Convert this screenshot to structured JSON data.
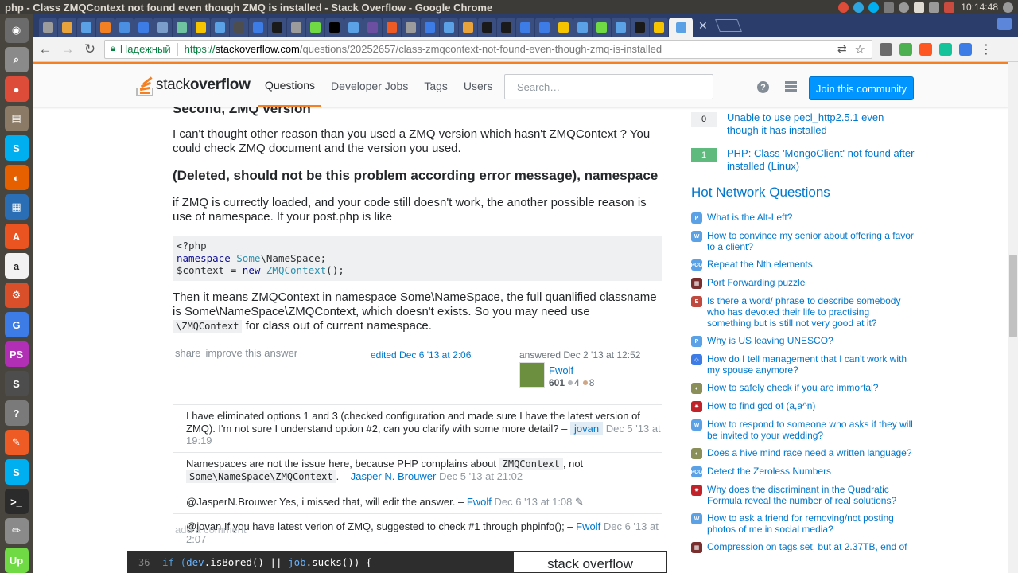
{
  "os": {
    "window_title": "php - Class ZMQContext not found even though ZMQ is installed - Stack Overflow - Google Chrome",
    "clock": "10:14:48",
    "tray_icons": [
      "chrome-icon",
      "telegram-icon",
      "skype-icon",
      "transfer-icon",
      "power-icon",
      "keyboard-layout-icon",
      "wifi-icon",
      "volume-mute-icon",
      "clock-icon"
    ]
  },
  "launcher": {
    "apps": [
      {
        "name": "ubuntu-dash",
        "color": "#6b6b6b",
        "glyph": "◉"
      },
      {
        "name": "screenshot-app",
        "color": "#8a8a8a",
        "glyph": "⌕"
      },
      {
        "name": "chrome-app",
        "color": "#dd4b39",
        "glyph": "●"
      },
      {
        "name": "files-app",
        "color": "#8a7a66",
        "glyph": "▤"
      },
      {
        "name": "skype-app",
        "color": "#00aff0",
        "glyph": "S"
      },
      {
        "name": "firefox-app",
        "color": "#e66000",
        "glyph": "◐"
      },
      {
        "name": "writer-app",
        "color": "#2a6eb6",
        "glyph": "▦"
      },
      {
        "name": "software-center-app",
        "color": "#e95420",
        "glyph": "A"
      },
      {
        "name": "amazon-app",
        "color": "#f2f2f2",
        "glyph": "a"
      },
      {
        "name": "settings-app",
        "color": "#d94f2a",
        "glyph": "⚙"
      },
      {
        "name": "grammarly-app",
        "color": "#3d7ce6",
        "glyph": "G"
      },
      {
        "name": "phpstorm-app",
        "color": "#b02fb5",
        "glyph": "PS"
      },
      {
        "name": "sublime-app",
        "color": "#4d4d4d",
        "glyph": "S"
      },
      {
        "name": "help-app",
        "color": "#7a7a7a",
        "glyph": "?"
      },
      {
        "name": "postman-app",
        "color": "#ef5b25",
        "glyph": "✎"
      },
      {
        "name": "skype-business-app",
        "color": "#00aff0",
        "glyph": "S"
      },
      {
        "name": "terminal-app",
        "color": "#2b2b2b",
        "glyph": ">_"
      },
      {
        "name": "pencil-app",
        "color": "#8a8a8a",
        "glyph": "✏"
      },
      {
        "name": "upwork-app",
        "color": "#6fda44",
        "glyph": "Up"
      }
    ]
  },
  "browser": {
    "tab_favicons": [
      "#9c9c9c",
      "#e8a33c",
      "#5aa1e6",
      "#f48024",
      "#4a8fe2",
      "#3d7ce6",
      "#7a9ec9",
      "#6fc3a0",
      "#f7c400",
      "#5aa1e6",
      "#4d4d4d",
      "#3d7ce6",
      "#1a1a1a",
      "#9c9c9c",
      "#6fda44",
      "#000000",
      "#5aa1e6",
      "#6c4fa0",
      "#ef5b25",
      "#9c9c9c",
      "#3d7ce6",
      "#5aa1e6",
      "#e8a33c",
      "#1a1a1a",
      "#1a1a1a",
      "#3d7ce6",
      "#3d7ce6",
      "#f7c400",
      "#5aa1e6",
      "#6fda44",
      "#5aa1e6",
      "#1a1a1a",
      "#f7c400",
      "#5aa1e6"
    ],
    "secure_label": "Надежный",
    "url_scheme": "https://",
    "url_host": "stackoverflow.com",
    "url_path": "/questions/20252657/class-zmqcontext-not-found-even-though-zmq-is-installed",
    "extension_colors": [
      "#6b6b6b",
      "#4caf50",
      "#ff5722",
      "#15c39a",
      "#3d7ce6"
    ]
  },
  "so": {
    "logo_light": "stack",
    "logo_bold": "overflow",
    "nav": [
      "Questions",
      "Developer Jobs",
      "Tags",
      "Users"
    ],
    "search_placeholder": "Search…",
    "help_glyph": "?",
    "join_label": "Join this community"
  },
  "answer": {
    "heading_prev": "Second, ZMQ version",
    "p1": "I can't thought other reason than you used a ZMQ version which hasn't ZMQContext ? You could check ZMQ document and the version you used.",
    "heading2": "(Deleted, should not be this problem according error message), namespace",
    "p2": "if ZMQ is currectly loaded, and your code still doesn't work, the another possible reason is use of namespace. If your post.php is like",
    "code_line1": "<?php",
    "code_line2_kw": "namespace",
    "code_line2_ns1": "Some",
    "code_line2_rest": "\\NameSpace;",
    "code_line3_var": "$context = ",
    "code_line3_kw": "new",
    "code_line3_cls": "ZMQContext",
    "code_line3_end": "();",
    "p3_text": "Then it means ZMQContext in namespace Some\\NameSpace, the full quanlified classname is Some\\NameSpace\\ZMQContext, which doesn't exists. So you may need use",
    "p3_code": "\\ZMQContext",
    "p3_tail": "for class out of current namespace.",
    "share": "share",
    "improve": "improve this answer",
    "edited": "edited Dec 6 '13 at 2:06",
    "answered": "answered Dec 2 '13 at 12:52",
    "user": "Fwolf",
    "rep": "601",
    "silver": "4",
    "bronze": "8"
  },
  "comments": [
    {
      "text": "I have eliminated options 1 and 3 (checked configuration and made sure I have the latest version of ZMQ). I'm not sure I understand option #2, can you clarify with some more detail? –",
      "user": "jovan",
      "date": "Dec 5 '13 at 19:19"
    },
    {
      "pre": "Namespaces are not the issue here, because PHP complains about",
      "code1": "ZMQContext",
      "mid": ", not",
      "code2": "Some\\NameSpace\\ZMQContext",
      "post": ". –",
      "user": "Jasper N. Brouwer",
      "date": "Dec 5 '13 at 21:02"
    },
    {
      "text": "@JasperN.Brouwer Yes, i missed that, will edit the answer. –",
      "user": "Fwolf",
      "date": "Dec 6 '13 at 1:08",
      "edit_glyph": "✎"
    },
    {
      "text": "@jovan If you have latest verion of ZMQ, suggested to check #1 through phpinfo(); –",
      "user": "Fwolf",
      "date": "Dec 6 '13 at 2:07"
    }
  ],
  "add_comment": "add a comment",
  "banner": {
    "line_no": "36",
    "code_pre": "if (",
    "code_dev": "dev",
    "code_mid": ".isBored() || ",
    "code_job": "job",
    "code_post": ".sucks()) {",
    "logo": "stack overflow"
  },
  "related": [
    {
      "score": "0",
      "accepted": false,
      "title": "Unable to use pecl_http2.5.1 even though it has installed"
    },
    {
      "score": "1",
      "accepted": true,
      "title": "PHP: Class 'MongoClient' not found after installed (Linux)"
    }
  ],
  "hnq_title": "Hot Network Questions",
  "hnq": [
    {
      "site": "politics-site-icon",
      "color": "#5aa1e6",
      "glyph": "P",
      "title": "What is the Alt-Left?"
    },
    {
      "site": "workplace-site-icon",
      "color": "#5aa1e6",
      "glyph": "W",
      "title": "How to convince my senior about offering a favor to a client?"
    },
    {
      "site": "codegolf-site-icon",
      "color": "#5aa1e6",
      "glyph": "PCG",
      "title": "Repeat the Nth elements"
    },
    {
      "site": "puzzling-site-icon",
      "color": "#7a2f2f",
      "glyph": "▦",
      "title": "Port Forwarding puzzle"
    },
    {
      "site": "english-site-icon",
      "color": "#c04a3f",
      "glyph": "E",
      "title": "Is there a word/ phrase to describe somebody who has devoted their life to practising something but is still not very good at it?"
    },
    {
      "site": "politics-site-icon",
      "color": "#5aa1e6",
      "glyph": "P",
      "title": "Why is US leaving UNESCO?"
    },
    {
      "site": "interpersonal-site-icon",
      "color": "#3d7ce6",
      "glyph": "◇",
      "title": "How do I tell management that I can't work with my spouse anymore?"
    },
    {
      "site": "worldbuilding-site-icon",
      "color": "#8a8f5a",
      "glyph": "◐",
      "title": "How to safely check if you are immortal?"
    },
    {
      "site": "math-site-icon",
      "color": "#c0242a",
      "glyph": "✸",
      "title": "How to find gcd of (a,a^n)"
    },
    {
      "site": "workplace-site-icon",
      "color": "#5aa1e6",
      "glyph": "W",
      "title": "How to respond to someone who asks if they will be invited to your wedding?"
    },
    {
      "site": "worldbuilding-site-icon",
      "color": "#8a8f5a",
      "glyph": "◐",
      "title": "Does a hive mind race need a written language?"
    },
    {
      "site": "codegolf-site-icon",
      "color": "#5aa1e6",
      "glyph": "PCG",
      "title": "Detect the Zeroless Numbers"
    },
    {
      "site": "math-site-icon",
      "color": "#c0242a",
      "glyph": "✸",
      "title": "Why does the discriminant in the Quadratic Formula reveal the number of real solutions?"
    },
    {
      "site": "workplace-site-icon",
      "color": "#5aa1e6",
      "glyph": "W",
      "title": "How to ask a friend for removing/not posting photos of me in social media?"
    },
    {
      "site": "puzzling-site-icon",
      "color": "#7a2f2f",
      "glyph": "▦",
      "title": "Compression on tags set, but at 2.37TB, end of"
    }
  ]
}
